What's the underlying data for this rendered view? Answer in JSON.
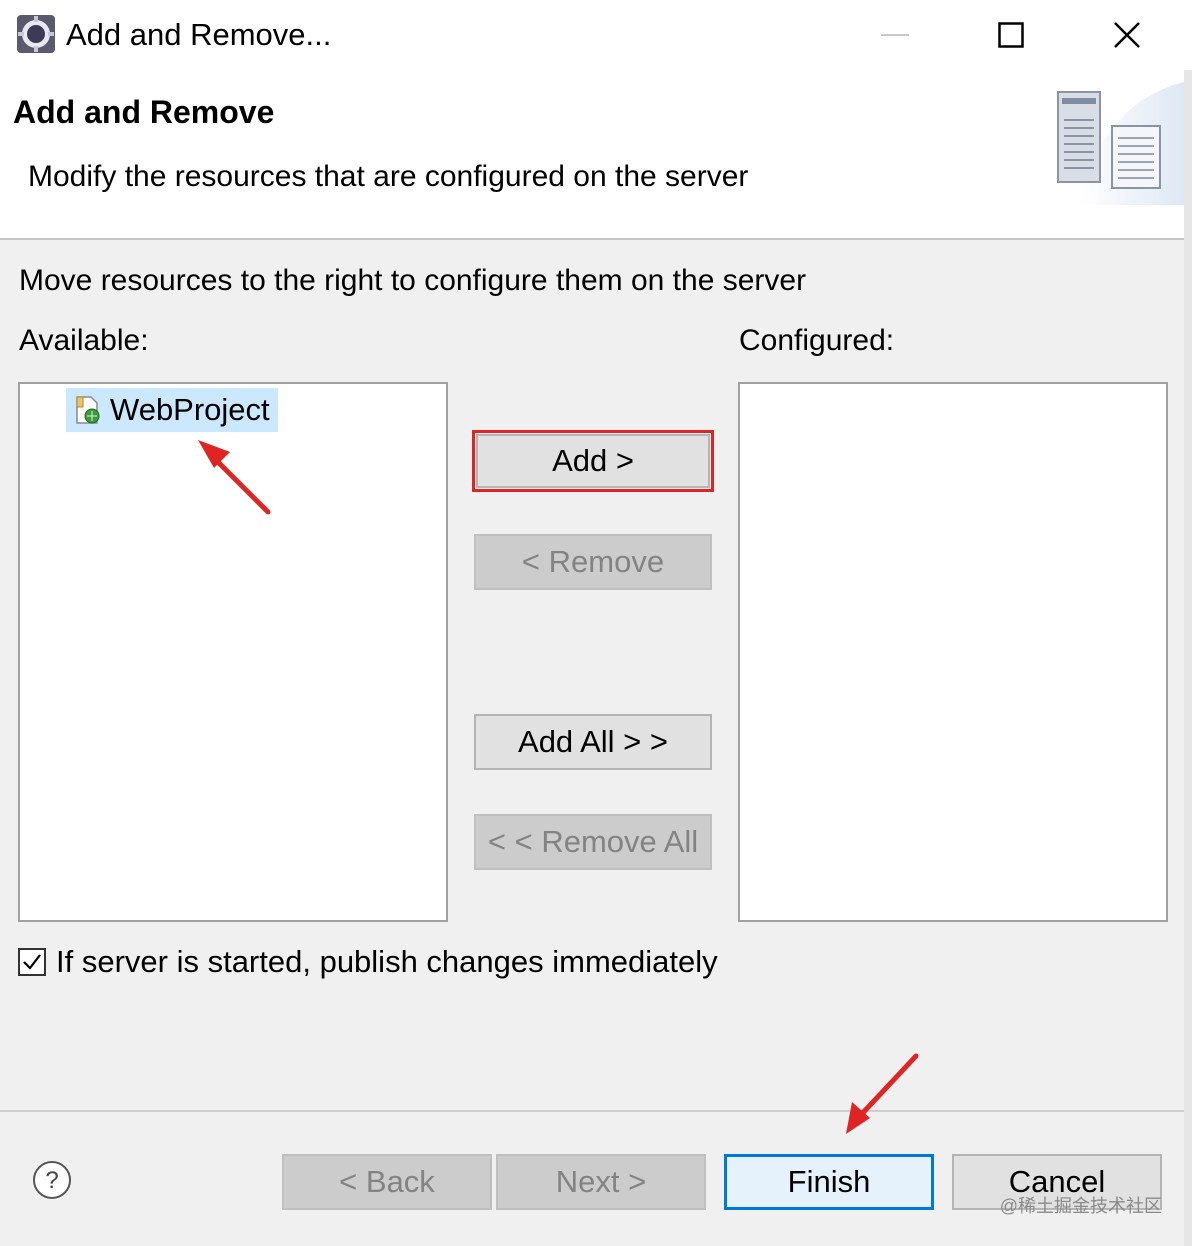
{
  "window": {
    "title": "Add and Remove...",
    "controls": {
      "minimize_icon": "minimize-icon",
      "maximize_icon": "maximize-icon",
      "close_icon": "close-icon"
    }
  },
  "header": {
    "title": "Add and Remove",
    "description": "Modify the resources that are configured on the server"
  },
  "main": {
    "instruction": "Move resources to the right to configure them on the server",
    "available_label": "Available:",
    "configured_label": "Configured:",
    "available_items": [
      {
        "label": "WebProject",
        "icon": "web-project-icon",
        "selected": true
      }
    ],
    "configured_items": []
  },
  "buttons": {
    "add": "Add >",
    "remove": "< Remove",
    "add_all": "Add All > >",
    "remove_all": "< < Remove All"
  },
  "options": {
    "publish_checkbox_label": "If server is started, publish changes immediately",
    "publish_checked": true
  },
  "footer": {
    "back": "< Back",
    "next": "Next >",
    "finish": "Finish",
    "cancel": "Cancel"
  },
  "watermark": "@稀土掘金技术社区",
  "colors": {
    "highlight_frame": "#e02424",
    "selection": "#cce8ff",
    "default_button_border": "#0078d7"
  }
}
